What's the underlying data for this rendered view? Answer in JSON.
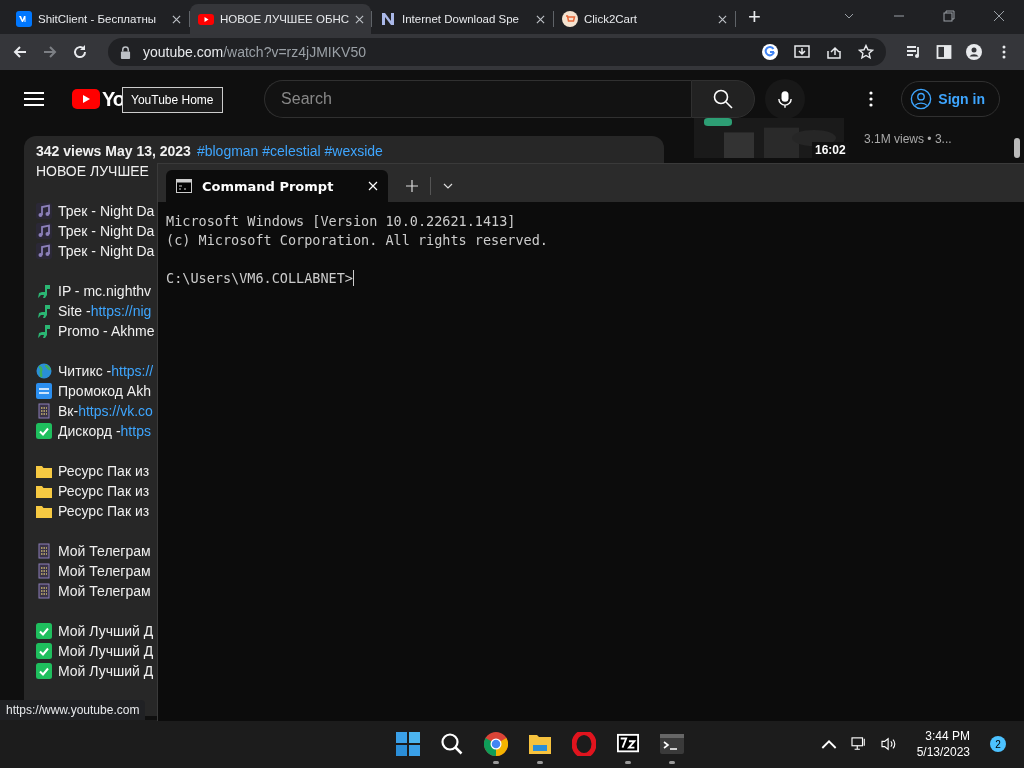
{
  "browser": {
    "tabs": [
      {
        "title": "ShitClient - Бесплатны",
        "kind": "vk",
        "selected": false
      },
      {
        "title": "НОВОЕ ЛУЧШЕЕ ОБНС",
        "kind": "youtube",
        "selected": true
      },
      {
        "title": "Internet Download Spe",
        "kind": "letter",
        "selected": false
      },
      {
        "title": "Click2Cart",
        "kind": "cart",
        "selected": false
      }
    ],
    "new_tab": "+",
    "address": {
      "host": "youtube.com",
      "path": "/watch?v=rz4jJMIKV50"
    }
  },
  "youtube": {
    "logo_text": "Yo",
    "tooltip": "YouTube Home",
    "search": {
      "placeholder": "Search"
    },
    "sign_in": "Sign in",
    "description": {
      "stats": "342 views  May 13, 2023",
      "hashtags": "#blogman #celestial #wexside",
      "title": "НОВОЕ ЛУЧШЕЕ",
      "groups": [
        [
          {
            "kind": "note",
            "text": "Трек - Night Da"
          },
          {
            "kind": "note",
            "text": "Трек - Night Da"
          },
          {
            "kind": "note",
            "text": "Трек - Night Da"
          }
        ],
        [
          {
            "kind": "dino",
            "text": "IP - mc.nighthv"
          },
          {
            "kind": "dino",
            "text": "Site - ",
            "link": "https://nig"
          },
          {
            "kind": "dino",
            "text": "Promo - Akhme"
          }
        ],
        [
          {
            "kind": "globe",
            "text": "Читикс - ",
            "link": "https://"
          },
          {
            "kind": "free",
            "text": "Промокод Akh"
          },
          {
            "kind": "abacus",
            "text": "Вк- ",
            "link": "https://vk.co"
          },
          {
            "kind": "check",
            "text": "Дискорд - ",
            "link": "https"
          }
        ],
        [
          {
            "kind": "folder",
            "text": "Ресурс Пак из"
          },
          {
            "kind": "folder",
            "text": "Ресурс Пак из"
          },
          {
            "kind": "folder",
            "text": "Ресурс Пак из"
          }
        ],
        [
          {
            "kind": "abacus",
            "text": "Мой Телеграм"
          },
          {
            "kind": "abacus",
            "text": "Мой Телеграм"
          },
          {
            "kind": "abacus",
            "text": "Мой Телеграм"
          }
        ],
        [
          {
            "kind": "check",
            "text": "Мой Лучший Д"
          },
          {
            "kind": "check",
            "text": "Мой Лучший Д"
          },
          {
            "kind": "check",
            "text": "Мой Лучший Д"
          }
        ]
      ]
    },
    "related": {
      "duration": "16:02",
      "meta": "3.1M views  • 3..."
    }
  },
  "status_url": "https://www.youtube.com",
  "terminal": {
    "tab": "Command Prompt",
    "output": [
      "Microsoft Windows [Version 10.0.22621.1413]",
      "(c) Microsoft Corporation. All rights reserved."
    ],
    "prompt": "C:\\Users\\VM6.COLLABNET>"
  },
  "taskbar": {
    "apps": [
      {
        "kind": "start",
        "running": false
      },
      {
        "kind": "search",
        "running": false
      },
      {
        "kind": "chrome",
        "running": true
      },
      {
        "kind": "explorer",
        "running": true
      },
      {
        "kind": "opera",
        "running": false
      },
      {
        "kind": "sevenzip",
        "running": true
      },
      {
        "kind": "terminal",
        "running": true
      }
    ],
    "time": "3:44 PM",
    "date": "5/13/2023",
    "notifications": "2"
  }
}
